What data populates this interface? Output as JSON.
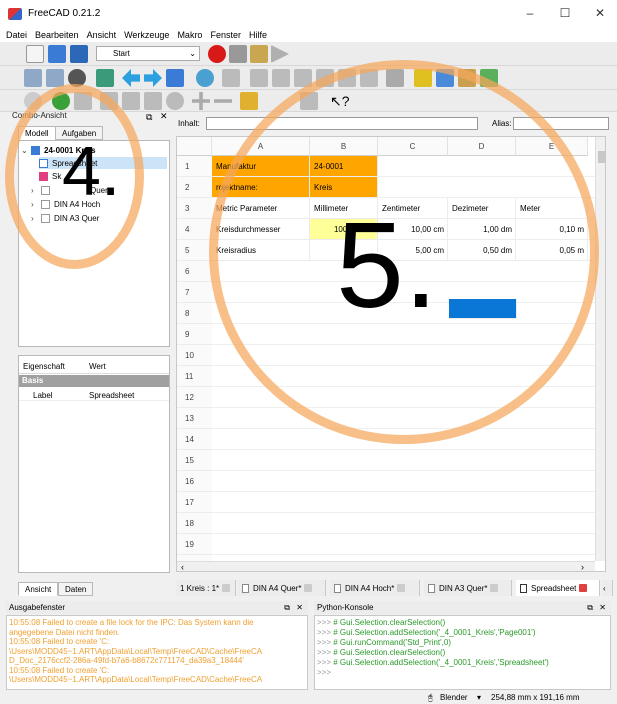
{
  "app": {
    "title": "FreeCAD 0.21.2"
  },
  "window_buttons": {
    "min": "–",
    "max": "☐",
    "close": "✕"
  },
  "menu": [
    "Datei",
    "Bearbeiten",
    "Ansicht",
    "Werkzeuge",
    "Makro",
    "Fenster",
    "Hilfe"
  ],
  "toolbar": {
    "workbench": "Start"
  },
  "combo": {
    "title": "Combo-Ansicht",
    "tabs": [
      "Modell",
      "Aufgaben"
    ]
  },
  "tree": {
    "root": "24-0001 Kreis",
    "items": [
      "Spreadsheet",
      "Sk",
      "Quer",
      "DIN A4 Hoch",
      "DIN A3 Quer"
    ]
  },
  "properties": {
    "headers": [
      "Eigenschaft",
      "Wert"
    ],
    "group": "Basis",
    "rows": [
      {
        "name": "Label",
        "value": "Spreadsheet"
      }
    ]
  },
  "left_bottom_tabs": [
    "Ansicht",
    "Daten"
  ],
  "sheet": {
    "inhalt_label": "Inhalt:",
    "alias_label": "Alias:",
    "columns": [
      "A",
      "B",
      "C",
      "D",
      "E"
    ],
    "rows": [
      "1",
      "2",
      "3",
      "4",
      "5",
      "6",
      "7",
      "8",
      "9",
      "10",
      "11",
      "12",
      "13",
      "14",
      "15",
      "16",
      "17",
      "18",
      "19",
      "20"
    ],
    "cells": {
      "A1": "Manufaktur",
      "B1": "24-0001",
      "A2": "rojektname:",
      "B2": "Kreis",
      "A3": "Metric Parameter",
      "B3": "Millimeter",
      "C3": "Zentimeter",
      "D3": "Dezimeter",
      "E3": "Meter",
      "A4": "Kreisdurchmesser",
      "B4": "100,00 mm",
      "C4": "10,00 cm",
      "D4": "1,00 dm",
      "E4": "0,10 m",
      "A5": "Kreisradius",
      "B5": "5",
      "C5": "5,00 cm",
      "D5": "0,50 dm",
      "E5": "0,05 m"
    }
  },
  "overlay": {
    "four": "4.",
    "five": "5."
  },
  "doc_tabs": [
    "1 Kreis : 1*",
    "DIN A4 Quer*",
    "DIN A4 Hoch*",
    "DIN A3 Quer*",
    "Spreadsheet"
  ],
  "output": {
    "title": "Ausgabefenster",
    "lines": [
      "10:55:08  Failed to create a file lock for the IPC: Das System kann die",
      "angegebene Datei nicht finden.",
      "10:55:08  Failed to create 'C:",
      "\\Users\\MODD45~1.ART\\AppData\\Local\\Temp\\FreeCAD\\Cache\\FreeCA",
      "D_Doc_2176ccf2-286a-49fd-b7a6-b8672c771174_da39a3_18444'",
      "10:55:08  Failed to create 'C:",
      "\\Users\\MODD45~1.ART\\AppData\\Local\\Temp\\FreeCAD\\Cache\\FreeCA"
    ]
  },
  "python": {
    "title": "Python-Konsole",
    "lines": [
      "# Gui.Selection.clearSelection()",
      "# Gui.Selection.addSelection('_4_0001_Kreis','Page001')",
      "# Gui.runCommand('Std_Print',0)",
      "# Gui.Selection.clearSelection()",
      "# Gui.Selection.addSelection('_4_0001_Kreis','Spreadsheet')"
    ],
    "prompt": ">>>"
  },
  "status": {
    "nav": "Blender",
    "dims": "254,88 mm x 191,16 mm"
  },
  "colors": {
    "orange": "#ffa500",
    "yellow": "#ffff99",
    "blue": "#0a76d6"
  }
}
